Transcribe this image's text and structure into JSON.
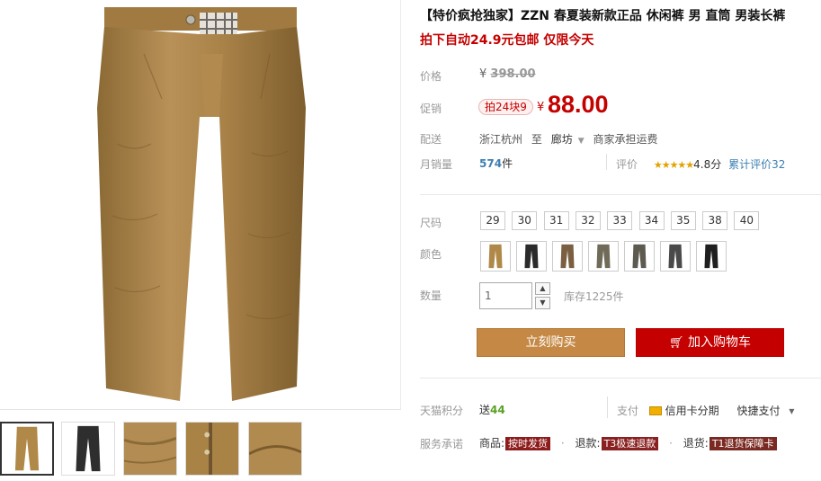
{
  "product": {
    "title": "【特价疯抢独家】ZZN 春夏装新款正品 休闲裤 男 直筒 男装长裤",
    "subtitle": "拍下自动24.9元包邮 仅限今天"
  },
  "price": {
    "label": "价格",
    "currency": "¥",
    "original": "398.00",
    "promo_label": "促销",
    "promo_badge": "拍24块9",
    "promo_price": "88.00"
  },
  "shipping": {
    "label": "配送",
    "from": "浙江杭州",
    "to_word": "至",
    "dest": "廊坊",
    "fee": "商家承担运费"
  },
  "sales": {
    "label": "月销量",
    "count": "574",
    "unit": "件",
    "rating_label": "评价",
    "stars": "★★★★★",
    "score": "4.8分",
    "total": "累计评价32"
  },
  "sizes": {
    "label": "尺码",
    "options": [
      "29",
      "30",
      "31",
      "32",
      "33",
      "34",
      "35",
      "38",
      "40"
    ]
  },
  "colors": {
    "label": "颜色",
    "swatches": [
      "#b08848",
      "#2b2b2b",
      "#7a6040",
      "#6f6b58",
      "#5d5a50",
      "#4a4a4a",
      "#1f1f1f"
    ]
  },
  "quantity": {
    "label": "数量",
    "value": "1",
    "up": "▲",
    "down": "▼",
    "stock": "库存1225件"
  },
  "actions": {
    "buy_now": "立刻购买",
    "add_cart": "加入购物车"
  },
  "points": {
    "label": "天猫积分",
    "send": "送",
    "value": "44",
    "pay_label": "支付",
    "credit": "信用卡分期",
    "quick": "快捷支付",
    "quick_arrow": "▾"
  },
  "service": {
    "label": "服务承诺",
    "goods": "商品:",
    "goods_tag": "按时发货",
    "refund": "退款:",
    "refund_tag": "T3极速退款",
    "return": "退货:",
    "return_tag": "T1退货保障卡",
    "dot": "·"
  },
  "colors_theme": {
    "accent_red": "#c40000",
    "buy_orange": "#c58945",
    "khaki": "#b08848"
  }
}
